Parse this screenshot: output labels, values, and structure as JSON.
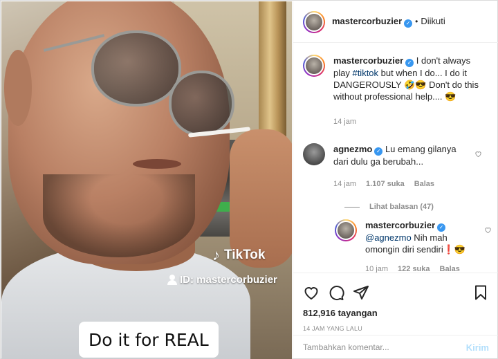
{
  "media": {
    "tiktok_brand": "TikTok",
    "tiktok_id": "ID: mastercorbuzier",
    "caption": "Do it for REAL"
  },
  "header": {
    "username": "mastercorbuzier",
    "separator": "•",
    "follow_status": "Diikuti"
  },
  "post": {
    "username": "mastercorbuzier",
    "text_before": " I don't always play ",
    "hashtag": "#tiktok",
    "text_after": " but when I do... I do it DANGEROUSLY 🤣😎 Don't do this without professional help.... 😎",
    "time": "14 jam"
  },
  "comments": [
    {
      "username": "agnezmo",
      "text": " Lu emang gilanya dari dulu ga berubah...",
      "time": "14 jam",
      "likes": "1.107 suka",
      "reply": "Balas"
    }
  ],
  "view_replies": "Lihat balasan (47)",
  "reply": {
    "username": "mastercorbuzier",
    "mention": "@agnezmo",
    "text": " Nih mah omongin diri sendiri❗😎",
    "time": "10 jam",
    "likes": "122 suka",
    "reply": "Balas"
  },
  "stats": {
    "views": "812,916 tayangan",
    "date": "14 JAM YANG LALU"
  },
  "add_comment": {
    "placeholder": "Tambahkan komentar...",
    "send": "Kirim"
  },
  "icons": {
    "like": "heart-icon",
    "comment": "comment-icon",
    "share": "share-icon",
    "save": "bookmark-icon",
    "verified": "verified-badge-icon"
  },
  "colors": {
    "link": "#00376b",
    "verified": "#3897f0",
    "muted": "#8e8e8e",
    "send_disabled": "#b2dffc"
  }
}
